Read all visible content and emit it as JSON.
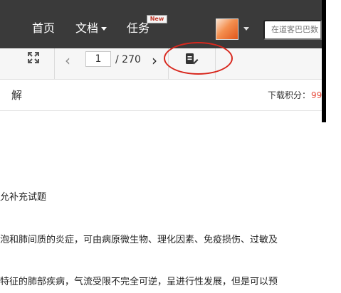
{
  "nav": {
    "items": [
      "首页",
      "文档",
      "任务"
    ],
    "badge": "New",
    "search_placeholder": "在道客巴巴数"
  },
  "toolbar": {
    "current_page": "1",
    "total_pages": "/ 270"
  },
  "doc": {
    "title": "解",
    "score_label": "下载积分：",
    "score_value": "99",
    "lines": [
      "允补充试题",
      "泡和肺间质的炎症，可由病原微生物、理化因素、免疫损伤、过敏及",
      "特征的肺部疾病，气流受限不完全可逆，呈进行性发展，但是可以预"
    ]
  },
  "colors": {
    "nav_bg": "#3a3a3a",
    "highlight_circle": "#d8281e",
    "score_value": "#e74c3c"
  }
}
